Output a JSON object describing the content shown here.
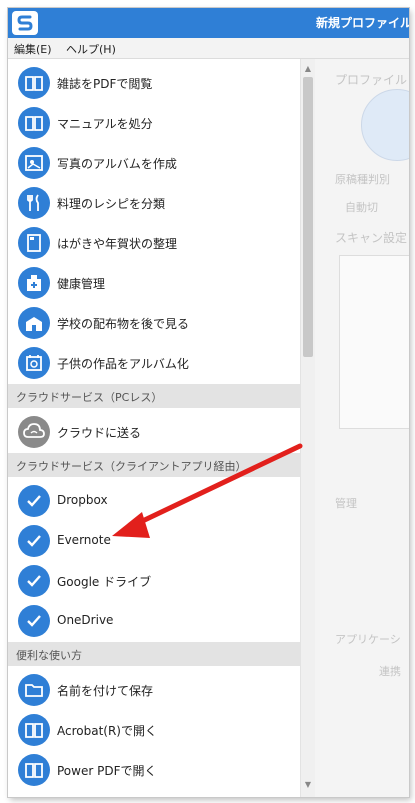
{
  "window": {
    "title": "新規プロファイル"
  },
  "menu": {
    "edit": "編集(E)",
    "help": "ヘルプ(H)"
  },
  "list": {
    "group_items": [
      {
        "label": "雑誌をPDFで閲覧",
        "icon": "book-icon"
      },
      {
        "label": "マニュアルを処分",
        "icon": "book-icon"
      },
      {
        "label": "写真のアルバムを作成",
        "icon": "photo-album-icon"
      },
      {
        "label": "料理のレシピを分類",
        "icon": "fork-knife-icon"
      },
      {
        "label": "はがきや年賀状の整理",
        "icon": "postcard-icon"
      },
      {
        "label": "健康管理",
        "icon": "hospital-icon"
      },
      {
        "label": "学校の配布物を後で見る",
        "icon": "school-icon"
      },
      {
        "label": "子供の作品をアルバム化",
        "icon": "kid-album-icon"
      }
    ],
    "section_cloud_pcless": "クラウドサービス（PCレス）",
    "cloud_send": {
      "label": "クラウドに送る",
      "icon": "cloud-sync-icon"
    },
    "section_cloud_client": "クラウドサービス（クライアントアプリ経由）",
    "client_items": [
      {
        "label": "Dropbox",
        "icon": "check-icon"
      },
      {
        "label": "Evernote",
        "icon": "check-icon"
      },
      {
        "label": "Google ドライブ",
        "icon": "check-icon"
      },
      {
        "label": "OneDrive",
        "icon": "check-icon"
      }
    ],
    "section_useful": "便利な使い方",
    "useful_items": [
      {
        "label": "名前を付けて保存",
        "icon": "folder-icon"
      },
      {
        "label": "Acrobat(R)で開く",
        "icon": "book-icon"
      },
      {
        "label": "Power PDFで開く",
        "icon": "book-icon"
      }
    ]
  },
  "right_panel": {
    "profile": "プロファイル",
    "doc_type": "原稿種判別",
    "auto": "自動切",
    "scan_settings": "スキャン設定",
    "manage": "管理",
    "application": "アプリケーシ",
    "link": "連携"
  },
  "colors": {
    "accent": "#2f7fd6",
    "arrow": "#e2201c",
    "section_bg": "#e3e3e3"
  }
}
